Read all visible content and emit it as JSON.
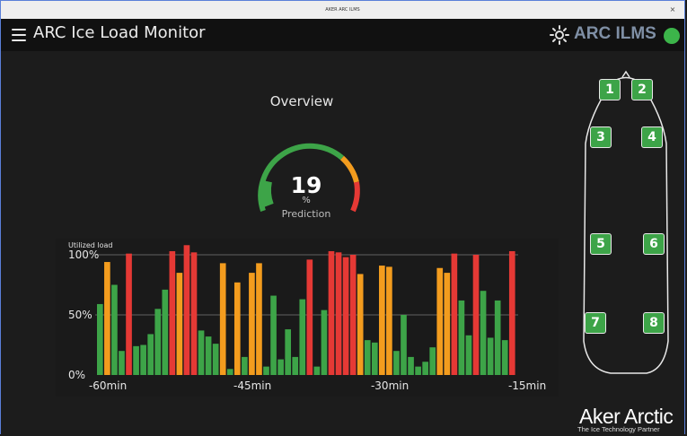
{
  "window": {
    "title": "AKER ARC ILMS",
    "close_glyph": "×"
  },
  "header": {
    "title": "ARC Ice Load Monitor",
    "brand": "ARC ILMS",
    "icons": [
      "menu-icon",
      "sun-icon"
    ],
    "status_color": "#3cb54a"
  },
  "overview": {
    "title": "Overview",
    "gauge_value": "19",
    "gauge_unit": "%",
    "gauge_label": "Prediction",
    "gauge_fraction": 0.19
  },
  "colors": {
    "green": "#3da448",
    "orange": "#f39c1e",
    "red": "#e53935"
  },
  "chart_data": {
    "type": "bar",
    "ylabel": "Utilized load",
    "ylim": [
      0,
      100
    ],
    "ytick_labels": [
      "100%",
      "50%",
      "0%"
    ],
    "yticks": [
      100,
      50,
      0
    ],
    "xtick_labels": [
      "-60min",
      "-45min",
      "-30min",
      "-15min"
    ],
    "xtick_indices": [
      1,
      21,
      40,
      59
    ],
    "values": [
      59,
      94,
      75,
      20,
      101,
      24,
      25,
      34,
      55,
      71,
      103,
      85,
      108,
      102,
      37,
      32,
      26,
      93,
      5,
      77,
      15,
      85,
      93,
      7,
      66,
      13,
      38,
      15,
      63,
      96,
      7,
      54,
      103,
      102,
      98,
      100,
      84,
      29,
      27,
      91,
      90,
      20,
      50,
      15,
      7,
      11,
      23,
      89,
      85,
      101,
      62,
      33,
      100,
      70,
      31,
      62,
      29,
      103
    ],
    "categories": [
      "g",
      "o",
      "g",
      "g",
      "r",
      "g",
      "g",
      "g",
      "g",
      "g",
      "r",
      "o",
      "r",
      "r",
      "g",
      "g",
      "g",
      "o",
      "g",
      "o",
      "g",
      "o",
      "o",
      "g",
      "g",
      "g",
      "g",
      "g",
      "g",
      "r",
      "g",
      "g",
      "r",
      "r",
      "r",
      "r",
      "o",
      "g",
      "g",
      "o",
      "o",
      "g",
      "g",
      "g",
      "g",
      "g",
      "g",
      "o",
      "o",
      "r",
      "g",
      "g",
      "r",
      "g",
      "g",
      "g",
      "g",
      "r"
    ]
  },
  "ship": {
    "compartments": [
      "1",
      "2",
      "3",
      "4",
      "5",
      "6",
      "7",
      "8"
    ]
  },
  "logo": {
    "name": "Aker Arctic",
    "tagline": "The Ice Technology Partner"
  }
}
